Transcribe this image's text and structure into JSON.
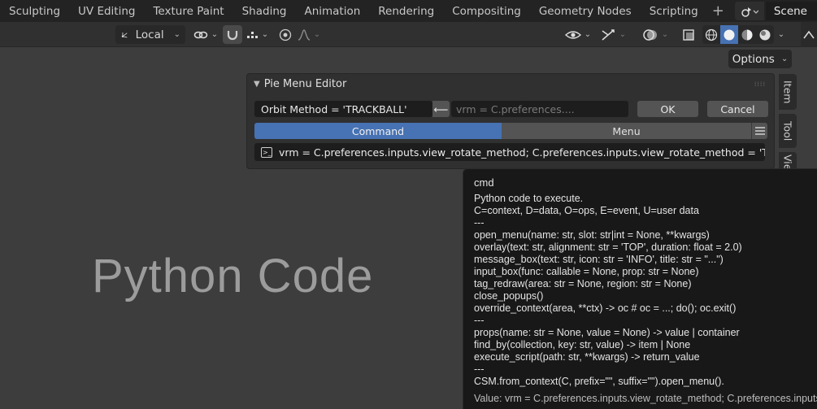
{
  "workspaces": [
    "Sculpting",
    "UV Editing",
    "Texture Paint",
    "Shading",
    "Animation",
    "Rendering",
    "Compositing",
    "Geometry Nodes",
    "Scripting"
  ],
  "add_workspace": "+",
  "scene": {
    "label": "Scene"
  },
  "toolbar": {
    "orientation_label": "Local"
  },
  "options_label": "Options",
  "side_tabs": [
    "Item",
    "Tool",
    "View"
  ],
  "panel": {
    "title": "Pie Menu Editor",
    "name_field": "Orbit Method = 'TRACKBALL'",
    "arrow": "⟵",
    "command_placeholder": "vrm = C.preferences....",
    "ok_label": "OK",
    "cancel_label": "Cancel",
    "tabs": {
      "command": "Command",
      "menu": "Menu"
    },
    "terminal_glyph": ">_",
    "command_text": "vrm = C.preferences.inputs.view_rotate_method; C.preferences.inputs.view_rotate_method = 'TRACKBALL'"
  },
  "overlay_text": "Python Code",
  "tooltip": {
    "title": "cmd",
    "lines": [
      "Python code to execute.",
      "C=context, D=data, O=ops, E=event, U=user data",
      "---",
      "open_menu(name: str, slot: str|int = None, **kwargs)",
      "overlay(text: str, alignment: str = 'TOP', duration: float = 2.0)",
      "message_box(text: str, icon: str = 'INFO', title: str = \"...\")",
      "input_box(func: callable = None, prop: str = None)",
      "tag_redraw(area: str = None, region: str = None)",
      "close_popups()",
      "override_context(area, **ctx)  -> oc  # oc = ...; do(); oc.exit()",
      "---",
      "props(name: str = None, value = None)  -> value | container",
      "find_by(collection, key: str, value)  -> item | None",
      "execute_script(path: str, **kwargs)  -> return_value",
      "---",
      "CSM.from_context(C, prefix=\"\", suffix=\"\").open_menu()."
    ],
    "value_line": "Value: vrm = C.preferences.inputs.view_rotate_method; C.preferences.inputs.view_rotate_method = 'TRACKBALL'"
  }
}
